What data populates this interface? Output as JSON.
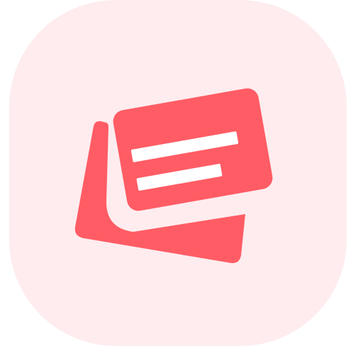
{
  "app_icon": {
    "icon": "flashcards-icon",
    "colors": {
      "tile_background": "#FEECEE",
      "card": "#FF5C65",
      "text_line": "#FFFFFF"
    }
  }
}
